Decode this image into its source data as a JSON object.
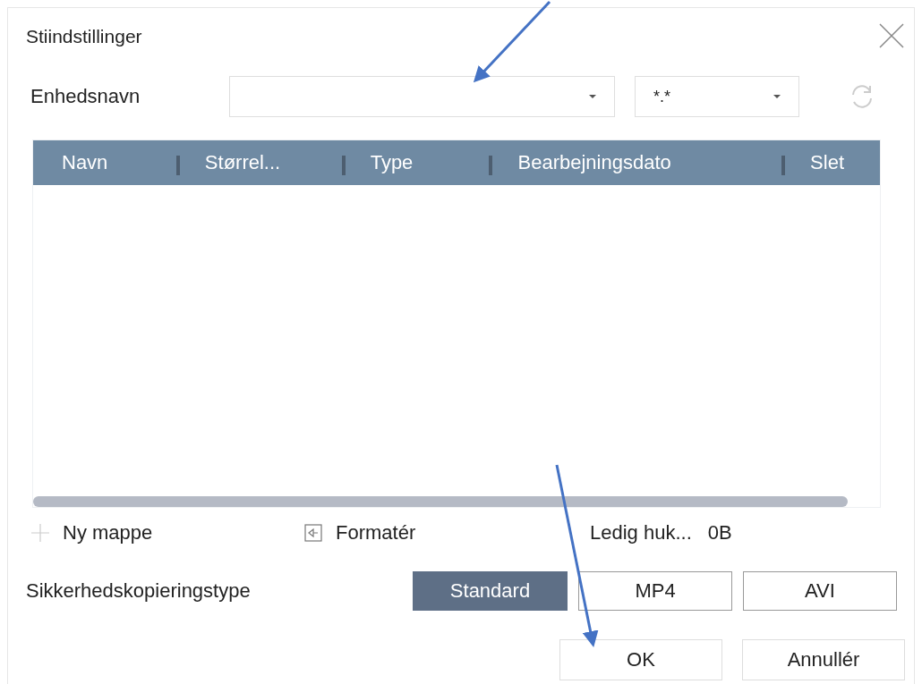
{
  "window": {
    "title": "Stiindstillinger"
  },
  "device": {
    "label": "Enhedsnavn",
    "filter": "*.*"
  },
  "table": {
    "columns": [
      "Navn",
      "Størrel...",
      "Type",
      "Bearbejningsdato",
      "Slet"
    ]
  },
  "actions": [
    {
      "kind": "new-folder",
      "label": "Ny mappe"
    },
    {
      "kind": "format",
      "label": "Formatér"
    }
  ],
  "free_space": {
    "label": "Ledig huk...",
    "value": "0B"
  },
  "backup_type": {
    "label": "Sikkerhedskopieringstype",
    "options": [
      {
        "label": "Standard",
        "selected": true
      },
      {
        "label": "MP4",
        "selected": false
      },
      {
        "label": "AVI",
        "selected": false
      }
    ]
  },
  "buttons": [
    "OK",
    "Annullér"
  ]
}
